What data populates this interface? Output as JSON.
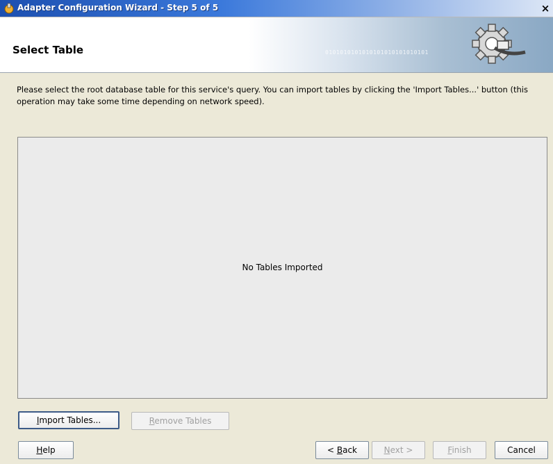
{
  "window": {
    "title": "Adapter Configuration Wizard - Step 5 of 5",
    "close_glyph": "×"
  },
  "banner": {
    "heading": "Select Table",
    "binary_text": "0101010101010101010101010101"
  },
  "instructions": "Please select the root database table for this service's query.  You can import tables by clicking the 'Import Tables...' button (this operation may take some time depending on network speed).",
  "tables": {
    "empty_message": "No Tables Imported"
  },
  "buttons": {
    "import_tables": {
      "mnemonic": "I",
      "rest": "mport Tables..."
    },
    "remove_tables": {
      "mnemonic": "R",
      "rest": "emove Tables"
    },
    "help": {
      "mnemonic": "H",
      "rest": "elp"
    },
    "back": {
      "prefix": "< ",
      "mnemonic": "B",
      "rest": "ack"
    },
    "next": {
      "mnemonic": "N",
      "rest": "ext >"
    },
    "finish": {
      "mnemonic": "F",
      "rest": "inish"
    },
    "cancel": {
      "label": "Cancel"
    }
  }
}
